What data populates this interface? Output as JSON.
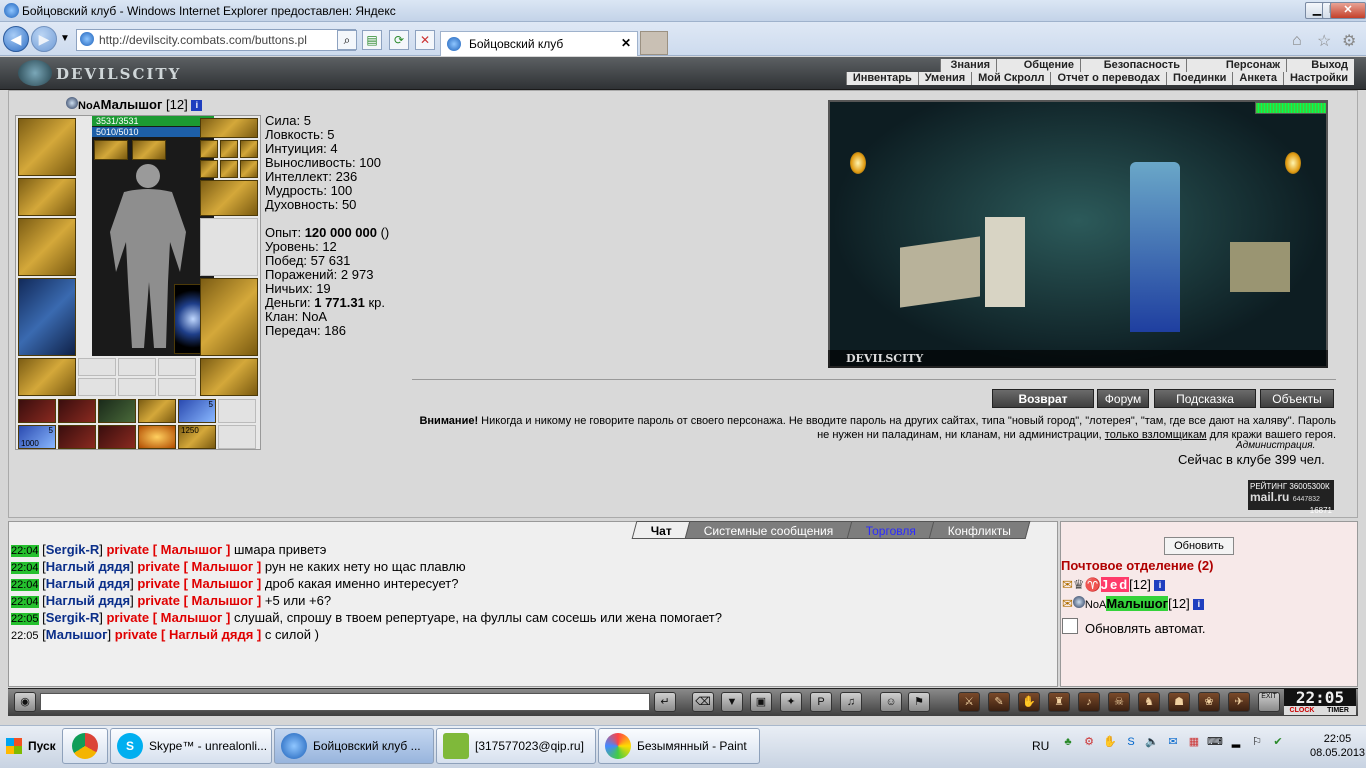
{
  "window": {
    "title": "Бойцовский клуб - Windows Internet Explorer предоставлен: Яндекс"
  },
  "browser": {
    "address": "http://devilscity.combats.com/buttons.pl",
    "tab_title": "Бойцовский клуб"
  },
  "header": {
    "logo": "DEVILSCITY",
    "menu_top": [
      "Знания",
      "Общение",
      "Безопасность",
      "Персонаж",
      "Выход"
    ],
    "menu_bottom": [
      "Инвентарь",
      "Умения",
      "Мой Скролл",
      "Отчет о переводах",
      "Поединки",
      "Анкета",
      "Настройки"
    ]
  },
  "character": {
    "clan_tag": "NoA",
    "name": "Малышог",
    "level": "[12]",
    "hp": "3531/3531",
    "mana": "5010/5010",
    "rune_counts": [
      "5",
      "1000",
      "5",
      "1250"
    ],
    "stats": [
      {
        "label": "Сила:",
        "value": "5"
      },
      {
        "label": "Ловкость:",
        "value": "5"
      },
      {
        "label": "Интуиция:",
        "value": "4"
      },
      {
        "label": "Выносливость:",
        "value": "100"
      },
      {
        "label": "Интеллект:",
        "value": "236"
      },
      {
        "label": "Мудрость:",
        "value": "100"
      },
      {
        "label": "Духовность:",
        "value": "50"
      }
    ],
    "info": {
      "exp_label": "Опыт:",
      "exp_value": "120 000 000",
      "exp_suffix": " ()",
      "level_label": "Уровень:",
      "level_value": "12",
      "wins_label": "Побед:",
      "wins_value": "57 631",
      "losses_label": "Поражений:",
      "losses_value": "2 973",
      "draws_label": "Ничьих:",
      "draws_value": "19",
      "money_label": "Деньги:",
      "money_value": "1 771.31",
      "money_suffix": " кр.",
      "clan_label": "Клан:",
      "clan_value": "NoA",
      "transfers_label": "Передач:",
      "transfers_value": "186"
    }
  },
  "scene": {
    "footer": "DEVILSCITY"
  },
  "buttons": {
    "return": "Возврат",
    "forum": "Форум",
    "hint": "Подсказка",
    "objects": "Объекты"
  },
  "warning": {
    "bold": "Внимание!",
    "text1": " Никогда и никому не говорите пароль от своего персонажа. Не вводите пароль на других сайтах, типа \"новый город\", \"лотерея\", \"там, где все дают на халяву\". Пароль не нужен ни паладинам, ни кланам, ни администрации, ",
    "link": "только взломщикам",
    "text2": " для кражи вашего героя.",
    "admin": "Администрация.",
    "online": "Сейчас в клубе 399 чел."
  },
  "rating": {
    "l1": "РЕЙТИНГ",
    "l2": "36005300К",
    "l3": "mail.ru",
    "l4": "6447832",
    "l5": "16871"
  },
  "chat_tabs": [
    "Чат",
    "Системные сообщения",
    "Торговля",
    "Конфликты"
  ],
  "chat": [
    {
      "time": "22:04",
      "nick": "Sergik-R",
      "to": "private [ Малышог ]",
      "msg": " шмара приветэ"
    },
    {
      "time": "22:04",
      "nick": "Наглый дядя",
      "to": "private [ Малышог ]",
      "msg": " рун не каких нету но щас плавлю"
    },
    {
      "time": "22:04",
      "nick": "Наглый дядя",
      "to": "private [ Малышог ]",
      "msg": " дроб какая именно интересует?"
    },
    {
      "time": "22:04",
      "nick": "Наглый дядя",
      "to": "private [ Малышог ]",
      "msg": " +5 или +6?"
    },
    {
      "time": "22:05",
      "nick": "Sergik-R",
      "to": "private [ Малышог ]",
      "msg": " слушай, спрошу в твоем репертуаре, на фуллы сам сосешь или жена помогает?"
    },
    {
      "time": "22:05",
      "nick": "Малышог",
      "to": "private [ Наглый дядя ]",
      "msg": " с силой )"
    }
  ],
  "right_panel": {
    "refresh": "Обновить",
    "post_title": "Почтовое отделение (2)",
    "user1_name": "Jed",
    "user1_level": "[12]",
    "user2_clan": "NoA",
    "user2_name": "Малышог",
    "user2_level": "[12]",
    "auto_label": "Обновлять автомат."
  },
  "clock": {
    "time": "22:05",
    "l1": "CLOCK",
    "l2": "TIMER",
    "exit": "EXIT"
  },
  "taskbar": {
    "start": "Пуск",
    "apps": [
      "Skype™ - unrealonli...",
      "Бойцовский клуб ...",
      "[317577023@qip.ru]",
      "Безымянный - Paint"
    ],
    "lang": "RU",
    "time": "22:05",
    "date": "08.05.2013"
  }
}
